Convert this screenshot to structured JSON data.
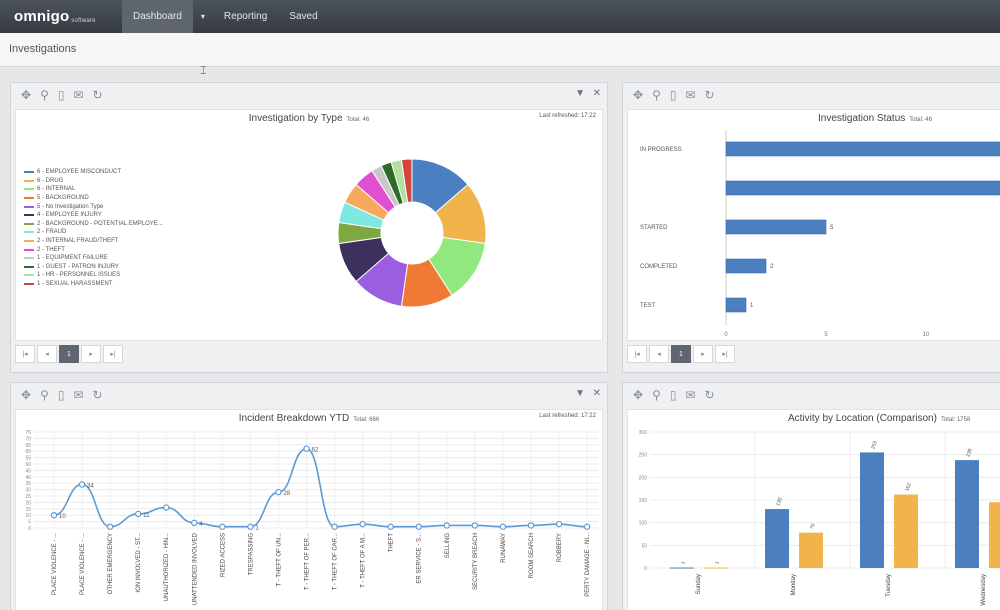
{
  "app": {
    "logo": "omnigo",
    "logo_sub": "software",
    "nav": [
      {
        "label": "Dashboard"
      },
      {
        "label": "▾"
      },
      {
        "label": "Reporting"
      },
      {
        "label": "Saved"
      }
    ],
    "page_title": "Investigations"
  },
  "panels": {
    "type": {
      "title": "Investigation by Type",
      "total": "Total: 46",
      "refreshed": "Last refreshed: 17:22",
      "page": "1"
    },
    "status": {
      "title": "Investigation Status",
      "total": "Total: 46",
      "page": "1"
    },
    "incident": {
      "title": "Incident Breakdown YTD",
      "total": "Total: 666",
      "refreshed": "Last refreshed: 17:22"
    },
    "activity": {
      "title": "Activity by Location (Comparison)",
      "total": "Total: 1758"
    }
  },
  "pager_labels": [
    "|◂",
    "◂",
    "1",
    "▸",
    "▸|"
  ],
  "chart_data": [
    {
      "type": "pie",
      "title": "Investigation by Type",
      "subtitle": "Total: 46",
      "categories": [
        "6 - EMPLOYEE MISCONDUCT",
        "6 - DRUG",
        "6 - INTERNAL",
        "5 - BACKGROUND",
        "5 - No Investigation Type",
        "4 - EMPLOYEE INJURY",
        "2 - BACKGROUND - POTENTIAL EMPLOYE...",
        "2 - FRAUD",
        "2 - INTERNAL FRAUD/THEFT",
        "2 - THEFT",
        "1 - EQUIPMENT FAILURE",
        "1 - GUEST - PATRON INJURY",
        "1 - HR - PERSONNEL ISSUES",
        "1 - SEXUAL HARASSMENT"
      ],
      "values": [
        6,
        6,
        6,
        5,
        5,
        4,
        2,
        2,
        2,
        2,
        1,
        1,
        1,
        1
      ],
      "colors": [
        "#4a7fc1",
        "#f0b44a",
        "#90e87e",
        "#ef7a35",
        "#9b5ee0",
        "#3d2f5e",
        "#7fa843",
        "#7fe8e0",
        "#f7a85e",
        "#e04fd0",
        "#c8c8c8",
        "#2e6b2a",
        "#b3e0a0",
        "#d2453c"
      ]
    },
    {
      "type": "bar",
      "title": "Investigation Status",
      "subtitle": "Total: 46",
      "categories": [
        "IN PROGRESS",
        "",
        "STARTED",
        "COMPLETED",
        "TEST"
      ],
      "values": [
        24,
        18,
        5,
        2,
        1
      ],
      "value_labels": [
        "",
        "",
        "5",
        "2",
        "1"
      ],
      "xticks": [
        0,
        5,
        10
      ],
      "orientation": "horizontal",
      "color": "#4b7fbf"
    },
    {
      "type": "line",
      "title": "Incident Breakdown YTD",
      "subtitle": "Total: 666",
      "y_ticks": [
        0,
        5,
        10,
        15,
        20,
        25,
        30,
        35,
        40,
        45,
        50,
        55,
        60,
        65,
        70,
        75
      ],
      "categories": [
        "PLACE VIOLENCE - ...",
        "PLACE VIOLENCE - ...",
        "OTHER EMERGENCY",
        "ION INVOLVED - ST...",
        "UNAUTHORIZED - HIN...",
        "UNATTENDED INVOLVED",
        "RIZED ACCESS",
        "TRESPASSING",
        "T - THEFT OF UN...",
        "T - THEFT OF PER...",
        "T - THEFT OF CAR...",
        "T - THEFT OF A M...",
        "THEFT",
        "ER SERVICE - S...",
        "SELLING",
        "SECURITY BREACH",
        "RUNAWAY",
        "ROOM SEARCH",
        "ROBBERY",
        "PERTY DAMAGE - NI..."
      ],
      "values": [
        10,
        34,
        1,
        11,
        16,
        4,
        1,
        1,
        28,
        62,
        1,
        3,
        1,
        1,
        2,
        2,
        1,
        2,
        3,
        1
      ],
      "point_labels": [
        "10",
        "34",
        "",
        "11",
        "",
        "4",
        "",
        "1",
        "28",
        "62",
        "",
        "",
        "",
        "",
        "",
        "",
        "",
        "",
        "",
        ""
      ],
      "ylim": [
        0,
        75
      ],
      "color": "#5b9bd5"
    },
    {
      "type": "bar",
      "title": "Activity by Location (Comparison)",
      "subtitle": "Total: 1758",
      "categories": [
        "Sunday",
        "Monday",
        "Tuesday",
        "Wednesday"
      ],
      "series": [
        {
          "values": [
            1,
            130,
            255,
            238
          ],
          "color": "#4b7fbf"
        },
        {
          "values": [
            1,
            78,
            162,
            145
          ],
          "color": "#f0b44a"
        }
      ],
      "value_labels": [
        [
          "1",
          "130",
          "255",
          "238"
        ],
        [
          "1",
          "78",
          "162",
          ""
        ]
      ],
      "y_ticks": [
        0,
        50,
        100,
        150,
        200,
        250,
        300
      ],
      "ylim": [
        0,
        300
      ]
    }
  ]
}
